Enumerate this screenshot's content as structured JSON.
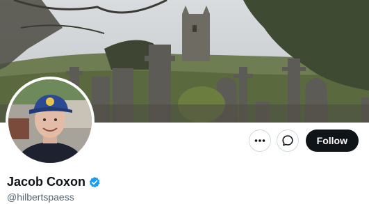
{
  "profile": {
    "display_name": "Jacob Coxon",
    "handle": "@hilbertspaess",
    "verified": true
  },
  "actions": {
    "more_icon": "more-horizontal-icon",
    "message_icon": "message-bubble-icon",
    "follow_label": "Follow"
  },
  "colors": {
    "follow_bg": "#0f1419",
    "verified_badge": "#1d9bf0",
    "handle_text": "#536471",
    "button_border": "#cfd9de"
  }
}
